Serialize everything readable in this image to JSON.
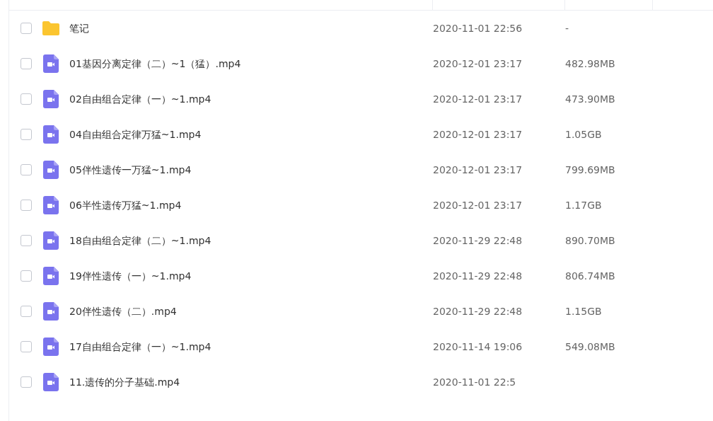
{
  "files": [
    {
      "kind": "folder",
      "name": "笔记",
      "modified": "2020-11-01 22:56",
      "size": "-",
      "checked": false
    },
    {
      "kind": "video",
      "name": "01基因分离定律（二）~1（猛）.mp4",
      "modified": "2020-12-01 23:17",
      "size": "482.98MB",
      "checked": false
    },
    {
      "kind": "video",
      "name": "02自由组合定律（一）~1.mp4",
      "modified": "2020-12-01 23:17",
      "size": "473.90MB",
      "checked": false
    },
    {
      "kind": "video",
      "name": "04自由组合定律万猛~1.mp4",
      "modified": "2020-12-01 23:17",
      "size": "1.05GB",
      "checked": false
    },
    {
      "kind": "video",
      "name": "05伴性遗传一万猛~1.mp4",
      "modified": "2020-12-01 23:17",
      "size": "799.69MB",
      "checked": false
    },
    {
      "kind": "video",
      "name": "06半性遗传万猛~1.mp4",
      "modified": "2020-12-01 23:17",
      "size": "1.17GB",
      "checked": false
    },
    {
      "kind": "video",
      "name": "18自由组合定律（二）~1.mp4",
      "modified": "2020-11-29 22:48",
      "size": "890.70MB",
      "checked": false
    },
    {
      "kind": "video",
      "name": "19伴性遗传（一）~1.mp4",
      "modified": "2020-11-29 22:48",
      "size": "806.74MB",
      "checked": false
    },
    {
      "kind": "video",
      "name": "20伴性遗传（二）.mp4",
      "modified": "2020-11-29 22:48",
      "size": "1.15GB",
      "checked": false
    },
    {
      "kind": "video",
      "name": "17自由组合定律（一）~1.mp4",
      "modified": "2020-11-14 19:06",
      "size": "549.08MB",
      "checked": false
    },
    {
      "kind": "video",
      "name": "11.遗传的分子基础.mp4",
      "modified": "2020-11-01 22:5",
      "checked": false
    }
  ]
}
